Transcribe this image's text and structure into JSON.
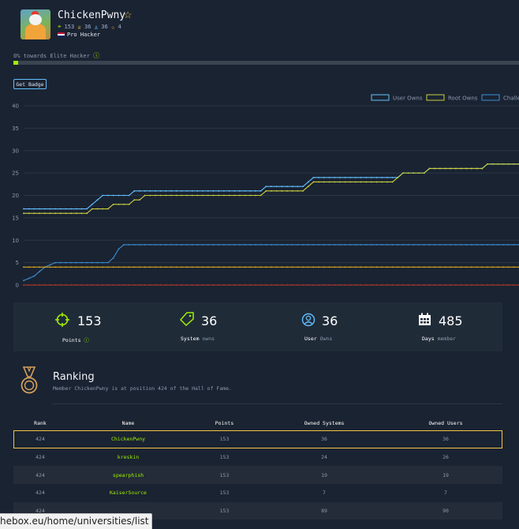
{
  "profile": {
    "username": "ChickenPwny",
    "points": "153",
    "system_owns": "36",
    "user_owns": "36",
    "rank_number": "4",
    "rank_title": "Pro Hacker"
  },
  "progress": {
    "label": "0% towards Elite Hacker",
    "percent": 0
  },
  "buttons": {
    "get_badge": "Get Badge"
  },
  "chart_data": {
    "type": "line",
    "ylim": [
      0,
      40
    ],
    "yticks": [
      "0",
      "5",
      "10",
      "15",
      "20",
      "25",
      "30",
      "35",
      "40"
    ],
    "legend_position": "top-right",
    "series": [
      {
        "name": "User Owns",
        "color": "#62c0ff",
        "values": [
          17,
          17,
          17,
          17,
          17,
          17,
          17,
          17,
          17,
          17,
          17,
          17,
          17,
          18,
          19,
          20,
          20,
          20,
          20,
          20,
          20,
          21,
          21,
          21,
          21,
          21,
          21,
          21,
          21,
          21,
          21,
          21,
          21,
          21,
          21,
          21,
          21,
          21,
          21,
          21,
          21,
          21,
          21,
          21,
          21,
          21,
          22,
          22,
          22,
          22,
          22,
          22,
          22,
          22,
          23,
          24,
          24,
          24,
          24,
          24,
          24,
          24,
          24,
          24,
          24,
          24,
          24,
          24,
          24,
          24,
          24,
          24,
          25,
          25,
          25,
          25,
          25,
          26,
          26,
          26,
          26,
          26,
          26,
          26,
          26,
          26,
          26,
          26,
          27,
          27,
          27,
          27,
          27,
          27,
          27
        ]
      },
      {
        "name": "Root Owns",
        "color": "#c8cf3f",
        "values": [
          16,
          16,
          16,
          16,
          16,
          16,
          16,
          16,
          16,
          16,
          16,
          16,
          16,
          17,
          17,
          17,
          17,
          18,
          18,
          18,
          18,
          19,
          19,
          20,
          20,
          20,
          20,
          20,
          20,
          20,
          20,
          20,
          20,
          20,
          20,
          20,
          20,
          20,
          20,
          20,
          20,
          20,
          20,
          20,
          20,
          20,
          21,
          21,
          21,
          21,
          21,
          21,
          21,
          21,
          22,
          23,
          23,
          23,
          23,
          23,
          23,
          23,
          23,
          23,
          23,
          23,
          23,
          23,
          23,
          23,
          23,
          24,
          25,
          25,
          25,
          25,
          25,
          26,
          26,
          26,
          26,
          26,
          26,
          26,
          26,
          26,
          26,
          26,
          27,
          27,
          27,
          27,
          27,
          27,
          27
        ]
      },
      {
        "name": "Challe",
        "color": "#3b8fd4",
        "values": [
          1,
          1.5,
          2,
          3,
          4,
          4.5,
          5,
          5,
          5,
          5,
          5,
          5,
          5,
          5,
          5,
          5,
          5,
          6,
          8,
          9,
          9,
          9,
          9,
          9,
          9,
          9,
          9,
          9,
          9,
          9,
          9,
          9,
          9,
          9,
          9,
          9,
          9,
          9,
          9,
          9,
          9,
          9,
          9,
          9,
          9,
          9,
          9,
          9,
          9,
          9,
          9,
          9,
          9,
          9,
          9,
          9,
          9,
          9,
          9,
          9,
          9,
          9,
          9,
          9,
          9,
          9,
          9,
          9,
          9,
          9,
          9,
          9,
          9,
          9,
          9,
          9,
          9,
          9,
          9,
          9,
          9,
          9,
          9,
          9,
          9,
          9,
          9,
          9,
          9,
          9,
          9,
          9,
          9,
          9,
          9
        ]
      },
      {
        "name": "",
        "color": "#d6a51e",
        "values": [
          4,
          4,
          4,
          4,
          4,
          4,
          4,
          4,
          4,
          4,
          4,
          4,
          4,
          4,
          4,
          4,
          4,
          4,
          4,
          4,
          4,
          4,
          4,
          4,
          4,
          4,
          4,
          4,
          4,
          4,
          4,
          4,
          4,
          4,
          4,
          4,
          4,
          4,
          4,
          4,
          4,
          4,
          4,
          4,
          4,
          4,
          4,
          4,
          4,
          4,
          4,
          4,
          4,
          4,
          4,
          4,
          4,
          4,
          4,
          4,
          4,
          4,
          4,
          4,
          4,
          4,
          4,
          4,
          4,
          4,
          4,
          4,
          4,
          4,
          4,
          4,
          4,
          4,
          4,
          4,
          4,
          4,
          4,
          4,
          4,
          4,
          4,
          4,
          4,
          4,
          4,
          4,
          4,
          4,
          4
        ]
      },
      {
        "name": "",
        "color": "#c0392b",
        "values": [
          0,
          0,
          0,
          0,
          0,
          0,
          0,
          0,
          0,
          0,
          0,
          0,
          0,
          0,
          0,
          0,
          0,
          0,
          0,
          0,
          0,
          0,
          0,
          0,
          0,
          0,
          0,
          0,
          0,
          0,
          0,
          0,
          0,
          0,
          0,
          0,
          0,
          0,
          0,
          0,
          0,
          0,
          0,
          0,
          0,
          0,
          0,
          0,
          0,
          0,
          0,
          0,
          0,
          0,
          0,
          0,
          0,
          0,
          0,
          0,
          0,
          0,
          0,
          0,
          0,
          0,
          0,
          0,
          0,
          0,
          0,
          0,
          0,
          0,
          0,
          0,
          0,
          0,
          0,
          0,
          0,
          0,
          0,
          0,
          0,
          0,
          0,
          0,
          0,
          0,
          0,
          0,
          0,
          0,
          0
        ]
      }
    ]
  },
  "stat_cards": [
    {
      "icon": "crosshair-icon",
      "value": "153",
      "label": "Points",
      "sub": "",
      "info": true,
      "color": "#9fef00"
    },
    {
      "icon": "tag-icon",
      "value": "36",
      "label": "System",
      "sub": "owns",
      "info": false,
      "color": "#9fef00"
    },
    {
      "icon": "user-owns-icon",
      "value": "36",
      "label": "User",
      "sub": "Owns",
      "info": false,
      "color": "#62c0ff"
    },
    {
      "icon": "calendar-icon",
      "value": "485",
      "label": "Days",
      "sub": "member",
      "info": false,
      "color": "#ffffff"
    }
  ],
  "ranking": {
    "title": "Ranking",
    "description": "Member ChickenPwny is at position 424 of the Hall of Fame.",
    "columns": [
      "Rank",
      "Name",
      "Points",
      "Owned Systems",
      "Owned Users"
    ],
    "rows": [
      {
        "rank": "424",
        "name": "ChickenPwny",
        "points": "153",
        "systems": "36",
        "users": "36",
        "highlight": true
      },
      {
        "rank": "424",
        "name": "kreskin",
        "points": "153",
        "systems": "24",
        "users": "26",
        "highlight": false
      },
      {
        "rank": "424",
        "name": "spearphish",
        "points": "153",
        "systems": "19",
        "users": "19",
        "highlight": false
      },
      {
        "rank": "424",
        "name": "KaiserSource",
        "points": "153",
        "systems": "7",
        "users": "7",
        "highlight": false
      },
      {
        "rank": "424",
        "name": "",
        "points": "153",
        "systems": "89",
        "users": "90",
        "highlight": false
      }
    ]
  },
  "status_bar": {
    "url": "hebox.eu/home/universities/list"
  }
}
